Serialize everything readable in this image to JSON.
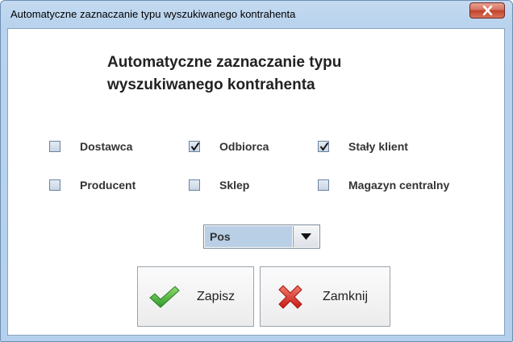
{
  "window": {
    "title": "Automatyczne zaznaczanie typu wyszukiwanego kontrahenta"
  },
  "dialog": {
    "heading_line1": "Automatyczne zaznaczanie typu",
    "heading_line2": "wyszukiwanego kontrahenta"
  },
  "checkboxes": [
    {
      "label": "Dostawca",
      "checked": false
    },
    {
      "label": "Odbiorca",
      "checked": true
    },
    {
      "label": "Stały klient",
      "checked": true
    },
    {
      "label": "Producent",
      "checked": false
    },
    {
      "label": "Sklep",
      "checked": false
    },
    {
      "label": "Magazyn centralny",
      "checked": false
    }
  ],
  "select": {
    "value": "Pos"
  },
  "buttons": {
    "save_label": "Zapisz",
    "close_label": "Zamknij"
  },
  "icons": {
    "window_close": "close-x-icon",
    "dropdown": "triangle-down-icon",
    "save": "green-check-icon",
    "close": "red-x-icon"
  },
  "colors": {
    "titlebar": "#b9d3ee",
    "close_button": "#c0422b",
    "select_highlight": "#b8cfe5",
    "save_icon": "#3ea73a",
    "close_icon": "#d5231c"
  }
}
